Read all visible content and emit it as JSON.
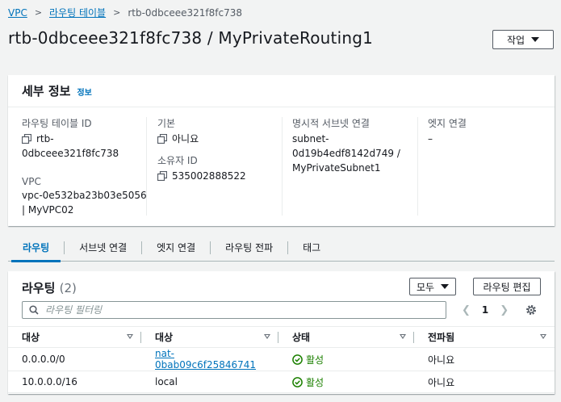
{
  "breadcrumb": {
    "items": [
      "VPC",
      "라우팅 테이블"
    ],
    "current": "rtb-0dbceee321f8fc738",
    "separator": ">"
  },
  "page": {
    "title": "rtb-0dbceee321f8fc738 / MyPrivateRouting1",
    "action_label": "작업"
  },
  "details": {
    "title": "세부 정보",
    "info_label": "정보",
    "route_table_id_label": "라우팅 테이블 ID",
    "route_table_id_line1": "rtb-",
    "route_table_id_line2": "0dbceee321f8fc738",
    "vpc_label": "VPC",
    "vpc_link_line1": "vpc-0e532ba23b03e5056",
    "vpc_link_line2": "| MyVPC02",
    "main_label": "기본",
    "main_value": "아니요",
    "owner_label": "소유자 ID",
    "owner_value": "535002888522",
    "explicit_subnet_label": "명시적 서브넷 연결",
    "subnet_link_line1": "subnet-",
    "subnet_link_line2": "0d19b4edf8142d749 /",
    "subnet_link_line3": "MyPrivateSubnet1",
    "edge_label": "엣지 연결",
    "edge_value": "–"
  },
  "tabs": [
    {
      "label": "라우팅",
      "active": true
    },
    {
      "label": "서브넷 연결",
      "active": false
    },
    {
      "label": "엣지 연결",
      "active": false
    },
    {
      "label": "라우팅 전파",
      "active": false
    },
    {
      "label": "태그",
      "active": false
    }
  ],
  "routes": {
    "title": "라우팅",
    "count": "(2)",
    "filter_value": "모두",
    "edit_label": "라우팅 편집",
    "search_placeholder": "라우팅 필터링",
    "page_number": "1",
    "columns": [
      "대상",
      "대상",
      "상태",
      "전파됨"
    ],
    "rows": [
      {
        "destination": "0.0.0.0/0",
        "target": "nat-0bab09c6f25846741",
        "status": "활성",
        "propagated": "아니요"
      },
      {
        "destination": "10.0.0.0/16",
        "target": "local",
        "status": "활성",
        "propagated": "아니요"
      }
    ]
  },
  "colors": {
    "link": "#0073bb",
    "success": "#1d8102",
    "border": "#eaeded",
    "background": "#f2f3f3"
  }
}
